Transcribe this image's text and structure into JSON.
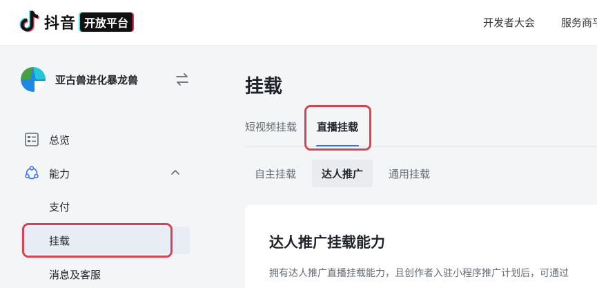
{
  "header": {
    "logo_text": "抖音",
    "logo_badge": "开放平台",
    "nav": [
      "开发者大会",
      "服务商平"
    ]
  },
  "sidebar": {
    "app_name": "亚古兽进化暴龙兽",
    "items": [
      {
        "label": "总览"
      },
      {
        "label": "能力"
      }
    ],
    "sub_items": [
      {
        "label": "支付"
      },
      {
        "label": "挂载"
      },
      {
        "label": "消息及客服"
      }
    ]
  },
  "main": {
    "title": "挂载",
    "tabs": [
      {
        "label": "短视频挂载"
      },
      {
        "label": "直播挂载"
      }
    ],
    "subtabs": [
      {
        "label": "自主挂载"
      },
      {
        "label": "达人推广"
      },
      {
        "label": "通用挂载"
      }
    ],
    "card": {
      "title": "达人推广挂载能力",
      "desc": "拥有达人推广直播挂载能力，且创作者入驻小程序推广计划后，可通过"
    }
  },
  "colors": {
    "accent": "#3370ff",
    "highlight": "#d9434f",
    "active_bg": "#e8ecf4"
  }
}
